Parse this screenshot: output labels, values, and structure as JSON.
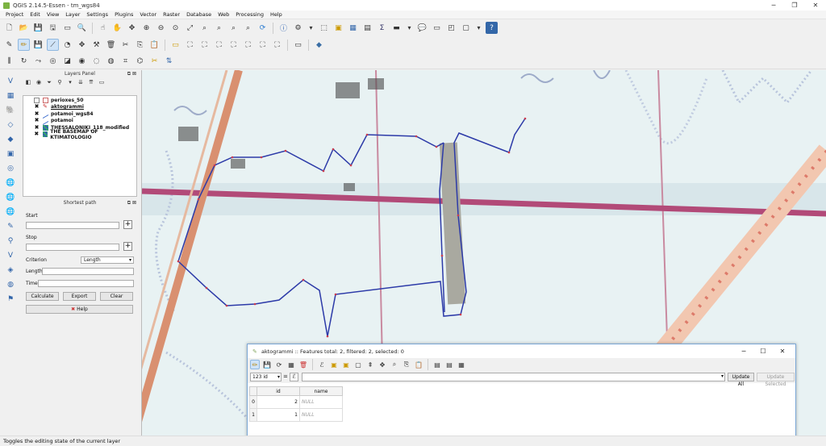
{
  "window": {
    "title": "QGIS 2.14.5-Essen - tm_wgs84"
  },
  "menu": [
    "Project",
    "Edit",
    "View",
    "Layer",
    "Settings",
    "Plugins",
    "Vector",
    "Raster",
    "Database",
    "Web",
    "Processing",
    "Help"
  ],
  "layers_panel": {
    "title": "Layers Panel",
    "layers": [
      {
        "name": "perioxes_50",
        "checked": false,
        "symbol": "polygon"
      },
      {
        "name": "aktogrammi",
        "checked": true,
        "symbol": "edit",
        "underline": true
      },
      {
        "name": "potamoi_wgs84",
        "checked": true,
        "symbol": "line"
      },
      {
        "name": "potamoi",
        "checked": true,
        "symbol": "line"
      },
      {
        "name": "THESSALONIKI_118_modified",
        "checked": true,
        "symbol": "raster"
      },
      {
        "name": "THE BASEMAP OF KTIMATOLOGIO",
        "checked": true,
        "symbol": "raster"
      }
    ]
  },
  "shortest_path": {
    "title": "Shortest path",
    "start_label": "Start",
    "stop_label": "Stop",
    "criterion_label": "Criterion",
    "criterion_value": "Length",
    "length_label": "Length",
    "time_label": "Time",
    "calculate": "Calculate",
    "export": "Export",
    "clear": "Clear",
    "help": "Help"
  },
  "attribute_table": {
    "title": "aktogrammi :: Features total: 2, filtered: 2, selected: 0",
    "field_selector": "123 id",
    "update_all": "Update All",
    "update_selected": "Update Selected",
    "columns": [
      "id",
      "name"
    ],
    "rows": [
      {
        "rownum": "0",
        "id": "2",
        "name": "NULL"
      },
      {
        "rownum": "1",
        "id": "1",
        "name": "NULL"
      }
    ]
  },
  "statusbar": {
    "text": "Toggles the editing state of the current layer"
  }
}
